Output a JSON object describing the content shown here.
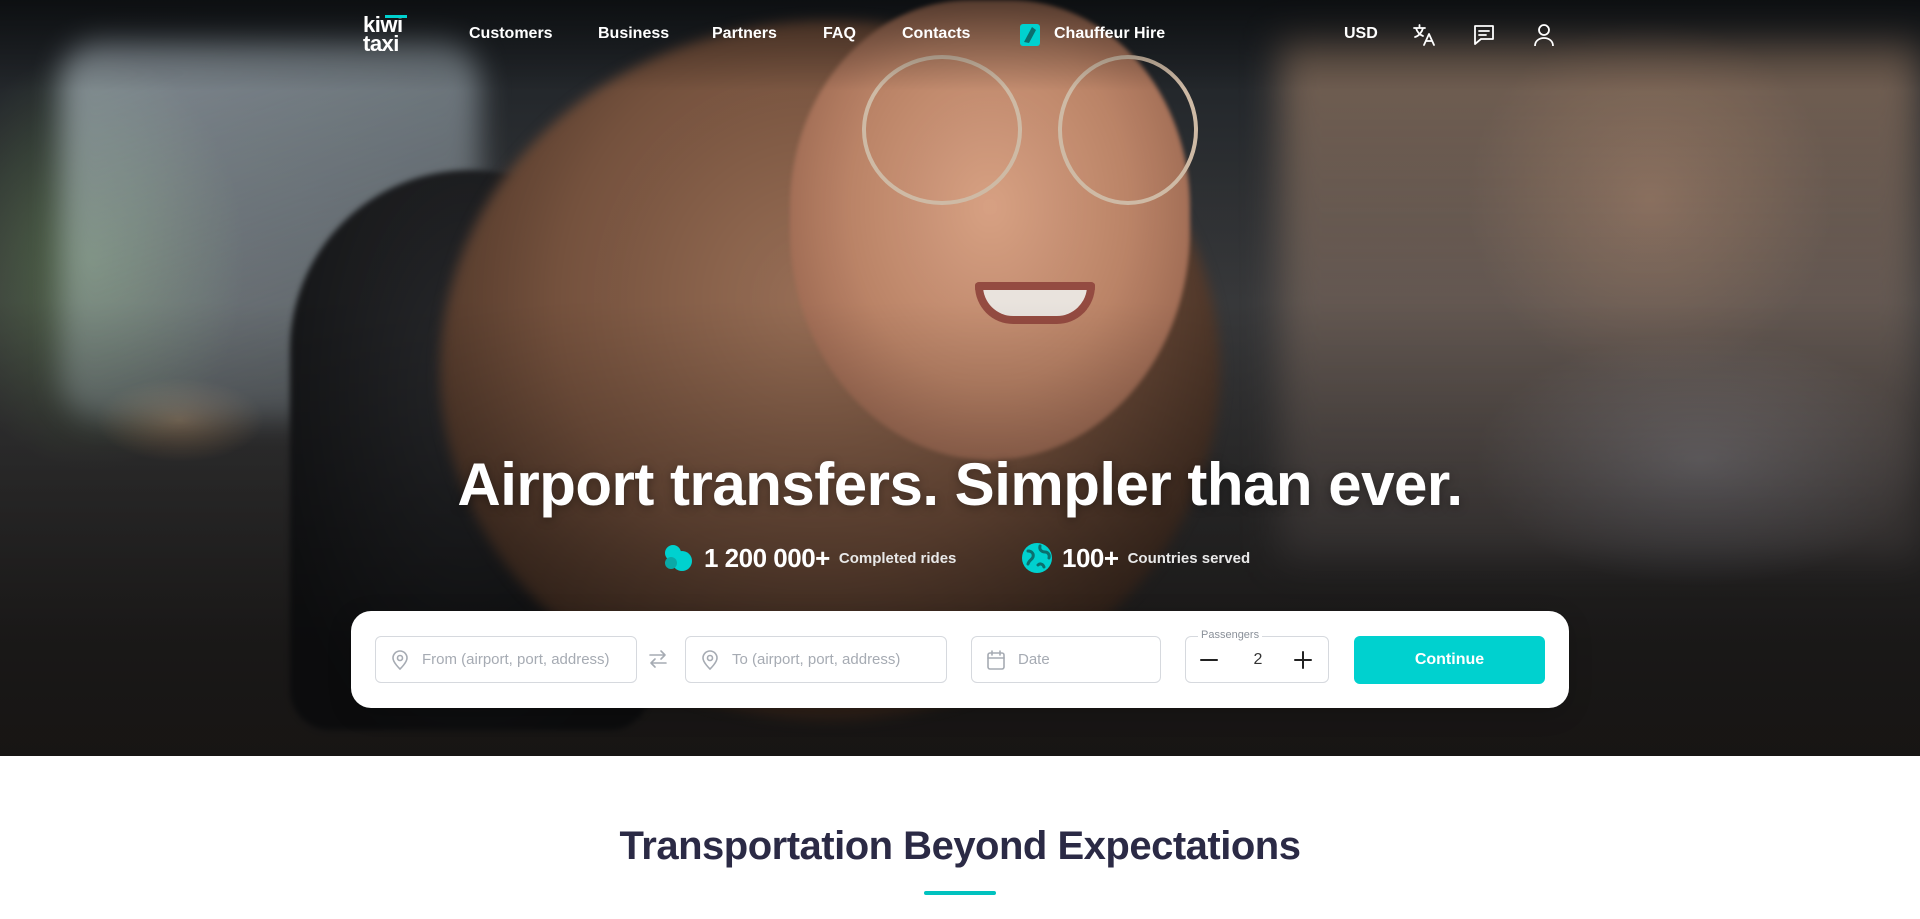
{
  "brand": {
    "logo_line1": "kiwi",
    "logo_line2": "taxi",
    "accent_color": "#00d1cf",
    "title_color": "#2b2a45"
  },
  "nav": {
    "items": [
      {
        "label": "Customers"
      },
      {
        "label": "Business"
      },
      {
        "label": "Partners"
      },
      {
        "label": "FAQ"
      },
      {
        "label": "Contacts"
      }
    ],
    "chauffeur": {
      "label": "Chauffeur Hire",
      "icon": "chauffeur-icon"
    },
    "currency": "USD",
    "icons": [
      "translate-icon",
      "chat-icon",
      "user-icon"
    ]
  },
  "hero": {
    "headline": "Airport transfers. Simpler than ever.",
    "stats": [
      {
        "icon": "cloud-rides-icon",
        "value": "1 200 000+",
        "label": "Completed rides"
      },
      {
        "icon": "globe-icon",
        "value": "100+",
        "label": "Countries served"
      }
    ]
  },
  "booking": {
    "from_placeholder": "From (airport, port, address)",
    "to_placeholder": "To (airport, port, address)",
    "date_placeholder": "Date",
    "passengers_label": "Passengers",
    "passengers_value": "2",
    "continue_label": "Continue"
  },
  "content": {
    "section_title": "Transportation Beyond Expectations"
  }
}
